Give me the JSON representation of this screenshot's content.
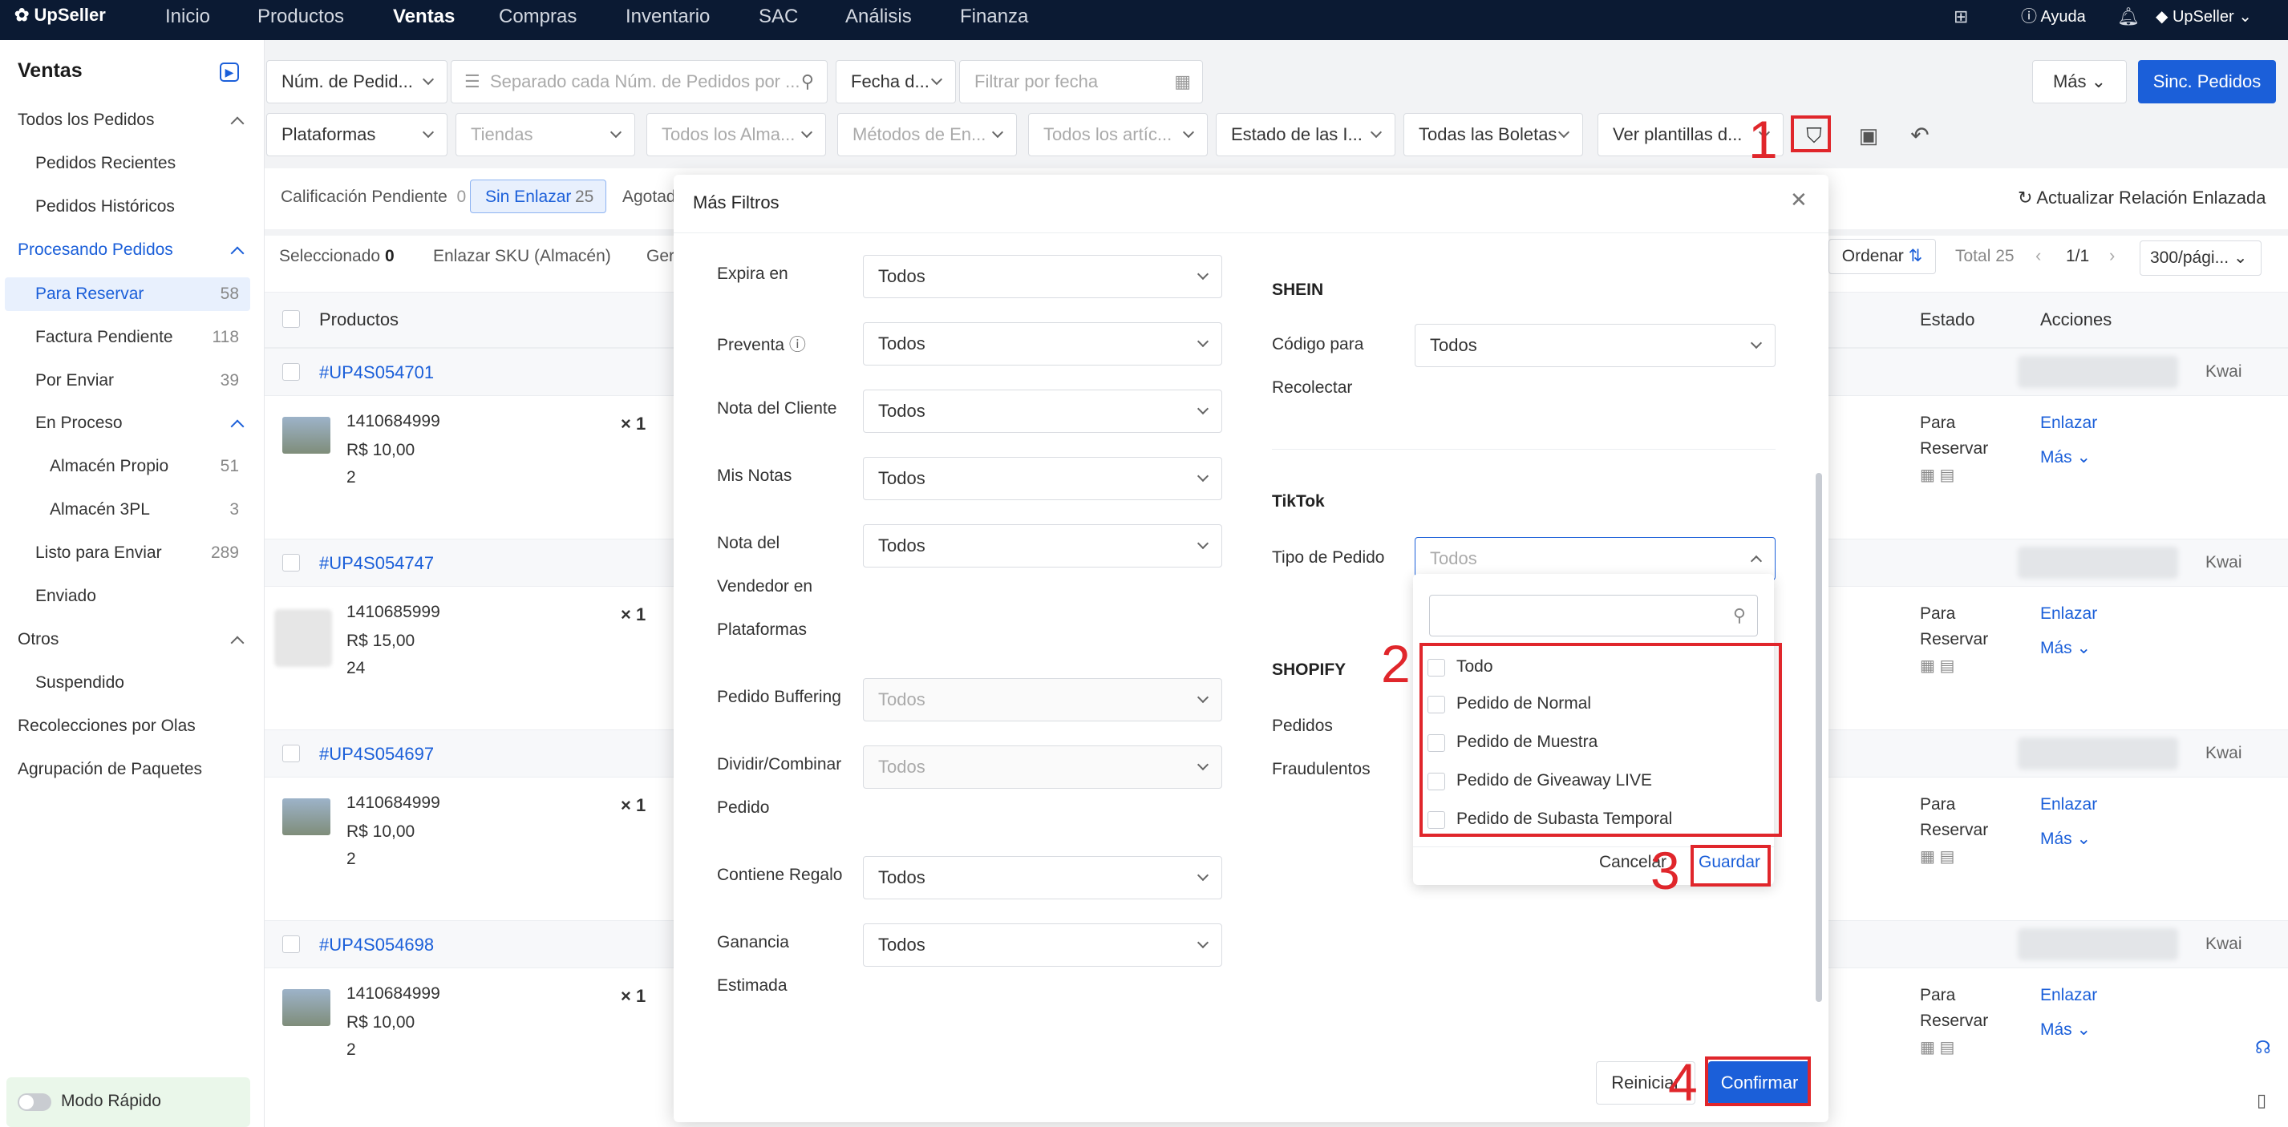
{
  "topbar": {
    "brand": "UpSeller",
    "nav": [
      "Inicio",
      "Productos",
      "Ventas",
      "Compras",
      "Inventario",
      "SAC",
      "Análisis",
      "Finanza"
    ],
    "active": "Ventas",
    "help": "Ayuda",
    "account": "UpSeller"
  },
  "sidebar": {
    "title": "Ventas",
    "all_orders": "Todos los Pedidos",
    "recent": "Pedidos Recientes",
    "history": "Pedidos Históricos",
    "processing": "Procesando Pedidos",
    "to_reserve": "Para Reservar",
    "to_reserve_count": "58",
    "invoice_pending": "Factura Pendiente",
    "invoice_pending_count": "118",
    "to_send": "Por Enviar",
    "to_send_count": "39",
    "in_process": "En Proceso",
    "own_warehouse": "Almacén Propio",
    "own_warehouse_count": "51",
    "warehouse_3pl": "Almacén 3PL",
    "warehouse_3pl_count": "3",
    "ready": "Listo para Enviar",
    "ready_count": "289",
    "sent": "Enviado",
    "others": "Otros",
    "suspended": "Suspendido",
    "waves": "Recolecciones por Olas",
    "grouping": "Agrupación de Paquetes",
    "quick_mode": "Modo Rápido"
  },
  "filters": {
    "order_num_select": "Núm. de Pedid...",
    "order_num_placeholder": "Separado cada Núm. de Pedidos por ...",
    "date_select": "Fecha d...",
    "date_placeholder": "Filtrar por fecha",
    "more": "Más",
    "sync": "Sinc. Pedidos",
    "platforms": "Plataformas",
    "stores": "Tiendas",
    "warehouses": "Todos los Alma...",
    "shipping": "Métodos de En...",
    "items": "Todos los artíc...",
    "status": "Estado de las I...",
    "tickets": "Todas las Boletas",
    "templates": "Ver plantillas d..."
  },
  "tabs": {
    "rating_pending": "Calificación Pendiente",
    "rating_pending_count": "0",
    "unlinked": "Sin Enlazar",
    "unlinked_count": "25",
    "out_of_stock": "Agotado",
    "update_link": "Actualizar Relación Enlazada"
  },
  "toolbar": {
    "selected": "Seleccionado",
    "selected_count": "0",
    "link_sku": "Enlazar SKU (Almacén)",
    "generate": "Ger",
    "order_sort": "Ordenar",
    "total": "Total 25",
    "page": "1/1",
    "per_page": "300/pági..."
  },
  "table": {
    "col_products": "Productos",
    "col_status": "Estado",
    "col_actions": "Acciones",
    "orders": [
      {
        "id": "#UP4S054701",
        "sku": "1410684999",
        "price": "R$ 10,00",
        "qty": "2",
        "mult": "× 1",
        "platform": "Kwai",
        "status1": "Para",
        "status2": "Reservar",
        "action": "Enlazar",
        "more": "Más"
      },
      {
        "id": "#UP4S054747",
        "sku": "1410685999",
        "price": "R$ 15,00",
        "qty": "24",
        "mult": "× 1",
        "platform": "Kwai",
        "status1": "Para",
        "status2": "Reservar",
        "action": "Enlazar",
        "more": "Más"
      },
      {
        "id": "#UP4S054697",
        "sku": "1410684999",
        "price": "R$ 10,00",
        "qty": "2",
        "mult": "× 1",
        "platform": "Kwai",
        "status1": "Para",
        "status2": "Reservar",
        "action": "Enlazar",
        "more": "Más"
      },
      {
        "id": "#UP4S054698",
        "sku": "1410684999",
        "price": "R$ 10,00",
        "qty": "2",
        "mult": "× 1",
        "platform": "Kwai",
        "status1": "Para",
        "status2": "Reservar",
        "action": "Enlazar",
        "more": "Más"
      }
    ]
  },
  "modal": {
    "title": "Más Filtros",
    "expires": "Expira en",
    "presale": "Preventa",
    "client_note": "Nota del Cliente",
    "my_notes": "Mis Notas",
    "seller_note_1": "Nota del",
    "seller_note_2": "Vendedor en",
    "seller_note_3": "Plataformas",
    "buffering": "Pedido Buffering",
    "split_1": "Dividir/Combinar",
    "split_2": "Pedido",
    "gift": "Contiene Regalo",
    "profit_1": "Ganancia",
    "profit_2": "Estimada",
    "all": "Todos",
    "shein": "SHEIN",
    "pickup_1": "Código para",
    "pickup_2": "Recolectar",
    "tiktok": "TikTok",
    "order_type": "Tipo de Pedido",
    "shopify": "SHOPIFY",
    "fraud_1": "Pedidos",
    "fraud_2": "Fraudulentos",
    "reset": "Reiniciar",
    "confirm": "Confirmar"
  },
  "dropdown": {
    "options": [
      "Todo",
      "Pedido de Normal",
      "Pedido de Muestra",
      "Pedido de Giveaway LIVE",
      "Pedido de Subasta Temporal"
    ],
    "cancel": "Cancelar",
    "save": "Guardar"
  },
  "annotations": [
    "1",
    "2",
    "3",
    "4"
  ],
  "colors": {
    "accent": "#1b5fd9",
    "highlight": "#e0262b",
    "topbar": "#0b1a33"
  }
}
